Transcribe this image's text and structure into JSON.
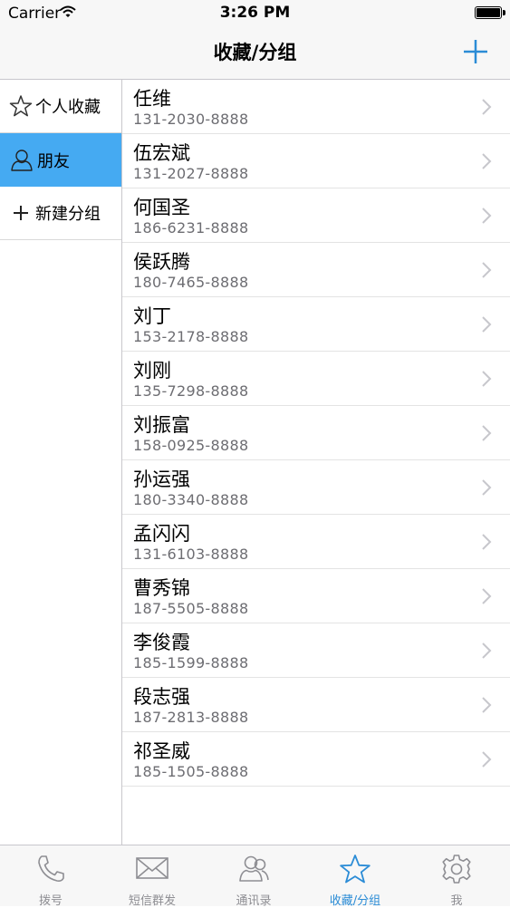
{
  "status": {
    "carrier": "Carrier",
    "time": "3:26 PM"
  },
  "nav": {
    "title": "收藏/分组",
    "add_icon": "plus-icon"
  },
  "sidebar": {
    "items": [
      {
        "label": "个人收藏",
        "icon": "star-outline-icon",
        "selected": false
      },
      {
        "label": "朋友",
        "icon": "person-outline-icon",
        "selected": true
      },
      {
        "label": "新建分组",
        "icon": "plus-icon",
        "selected": false
      }
    ]
  },
  "contacts": [
    {
      "name": "任维",
      "phone": "131-2030-8888"
    },
    {
      "name": "伍宏斌",
      "phone": "131-2027-8888"
    },
    {
      "name": "何国圣",
      "phone": "186-6231-8888"
    },
    {
      "name": "侯跃腾",
      "phone": "180-7465-8888"
    },
    {
      "name": "刘丁",
      "phone": "153-2178-8888"
    },
    {
      "name": "刘刚",
      "phone": "135-7298-8888"
    },
    {
      "name": "刘振富",
      "phone": "158-0925-8888"
    },
    {
      "name": "孙运强",
      "phone": "180-3340-8888"
    },
    {
      "name": "孟闪闪",
      "phone": "131-6103-8888"
    },
    {
      "name": "曹秀锦",
      "phone": "187-5505-8888"
    },
    {
      "name": "李俊霞",
      "phone": "185-1599-8888"
    },
    {
      "name": "段志强",
      "phone": "187-2813-8888"
    },
    {
      "name": "祁圣威",
      "phone": "185-1505-8888"
    }
  ],
  "tabs": [
    {
      "label": "拨号",
      "icon": "phone-icon",
      "active": false
    },
    {
      "label": "短信群发",
      "icon": "envelope-icon",
      "active": false
    },
    {
      "label": "通讯录",
      "icon": "contacts-icon",
      "active": false
    },
    {
      "label": "收藏/分组",
      "icon": "star-icon",
      "active": true
    },
    {
      "label": "我",
      "icon": "gear-icon",
      "active": false
    }
  ],
  "colors": {
    "accent": "#2b8cd6",
    "selected_bg": "#45aaf2",
    "tab_inactive": "#8e8e93"
  }
}
